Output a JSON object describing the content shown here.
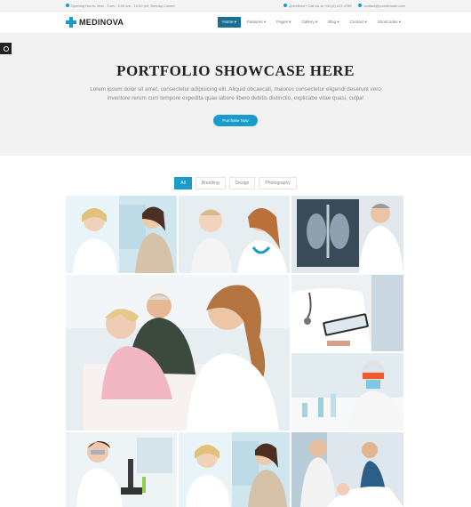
{
  "topbar": {
    "hours": "Opening Hours: Mon - Tues : 6.00 am - 10.00 pm, Sunday Closed",
    "call": "Questions? Call Us at +00 (0) 123 4789",
    "email": "contact@yourdomain.com"
  },
  "brand": {
    "name": "MEDINOVA",
    "accent": "#1a9bc9"
  },
  "nav": [
    "Home ▾",
    "Features ▾",
    "Pages ▾",
    "Gallery ▾",
    "Blog ▾",
    "Contact ▾",
    "Shortcodes ▾"
  ],
  "hero": {
    "title": "PORTFOLIO SHOWCASE HERE",
    "text": "Lorem ipsum dolor sit amet, consectetur adipisicing elit. Aliquid obcaecati, maiores consectetur eligendi deserunt vero inventore rerum cum tempore expedita quae labore libero debitis distinctio, explicabo vitae quasi, culpa!",
    "button": "Purchase Now"
  },
  "filters": [
    "All",
    "Branding",
    "Design",
    "Photography"
  ],
  "portfolio": [
    "doctor-with-child-photo",
    "doctor-with-baby-photo",
    "doctor-xray-photo",
    "nurse-with-elderly-patients-photo",
    "doctor-tablet-photo",
    "lab-researcher-photo",
    "lab-woman-microscope-photo",
    "doctor-with-child-photo-2",
    "doctor-with-patient-bed-photo"
  ]
}
